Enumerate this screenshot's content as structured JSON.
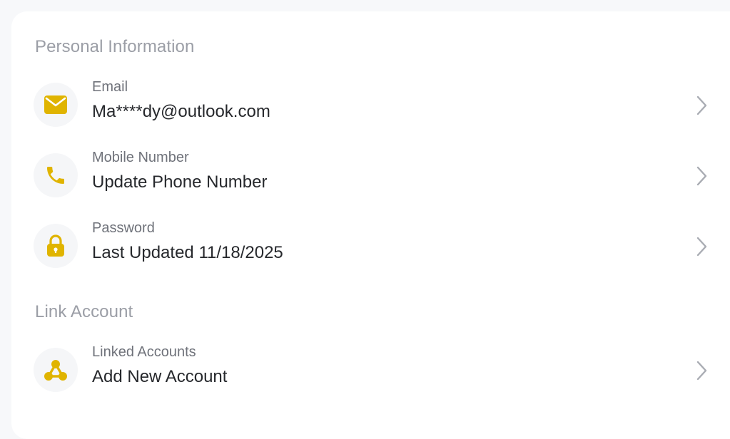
{
  "sections": {
    "personal": {
      "title": "Personal Information",
      "rows": [
        {
          "label": "Email",
          "value": "Ma****dy@outlook.com",
          "icon": "envelope-icon"
        },
        {
          "label": "Mobile Number",
          "value": "Update Phone Number",
          "icon": "phone-icon"
        },
        {
          "label": "Password",
          "value": "Last Updated 11/18/2025",
          "icon": "lock-icon"
        }
      ]
    },
    "link": {
      "title": "Link Account",
      "rows": [
        {
          "label": "Linked Accounts",
          "value": "Add New Account",
          "icon": "linked-nodes-icon"
        }
      ]
    }
  },
  "colors": {
    "accent": "#e0b400",
    "icon_bg": "#f5f6f8",
    "section_title": "#9b9ea6",
    "label": "#6f727a",
    "value": "#26282c",
    "chevron": "#a9acb3"
  }
}
